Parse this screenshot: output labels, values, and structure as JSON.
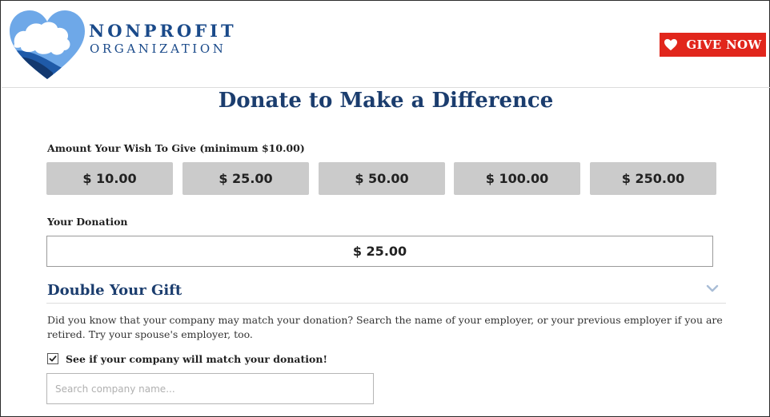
{
  "brand": {
    "name_line1": "NONPROFIT",
    "name_line2": "ORGANIZATION",
    "logo_icon": "heart-cloud-logo"
  },
  "header": {
    "give_button_label": "GIVE NOW",
    "give_button_icon": "heart-icon",
    "give_button_color": "#e1261c"
  },
  "main": {
    "title": "Donate to Make a Difference",
    "amount_label": "Amount Your Wish To Give (minimum $10.00)",
    "amount_options": [
      "$ 10.00",
      "$ 25.00",
      "$ 50.00",
      "$ 100.00",
      "$ 250.00"
    ],
    "donation_label": "Your Donation",
    "donation_value": "$ 25.00"
  },
  "double_gift": {
    "title": "Double Your Gift",
    "chevron_icon": "chevron-down-icon",
    "description": "Did you know that your company may match your donation? Search the name of your employer, or your previous employer if you are retired. Try your spouse's employer, too.",
    "checkbox_checked": true,
    "checkbox_label": "See if your company will match your donation!",
    "search_placeholder": "Search company name..."
  },
  "colors": {
    "navy": "#1b3d6e",
    "brand_blue": "#1a4a8a",
    "amount_button_bg": "#cbcbcb"
  }
}
